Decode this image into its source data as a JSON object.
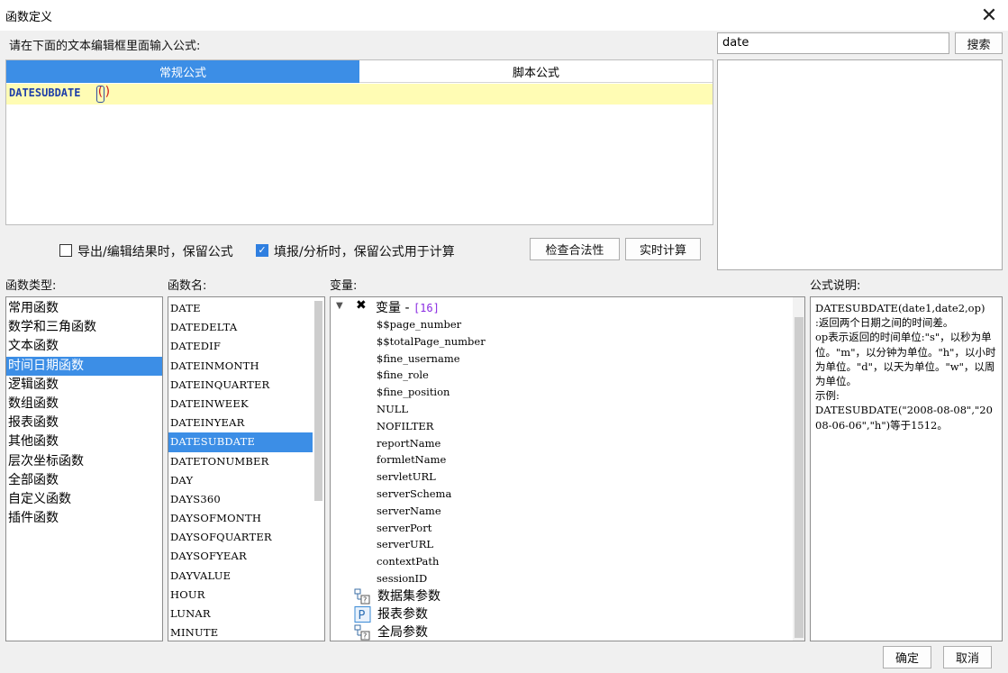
{
  "window": {
    "title": "函数定义",
    "close_glyph": "✕"
  },
  "editor": {
    "prompt": "请在下面的文本编辑框里面输入公式:",
    "tabs": [
      {
        "label": "常规公式",
        "active": true
      },
      {
        "label": "脚本公式",
        "active": false
      }
    ],
    "formula_function": "DATESUBDATE",
    "formula_parens": "()"
  },
  "search": {
    "value": "date",
    "button_label": "搜索"
  },
  "options": {
    "keep_formula_export": {
      "label": "导出/编辑结果时，保留公式",
      "checked": false
    },
    "keep_formula_fill": {
      "label": "填报/分析时，保留公式用于计算",
      "checked": true
    },
    "check_button": "检查合法性",
    "realtime_button": "实时计算"
  },
  "panels": {
    "types_label": "函数类型:",
    "names_label": "函数名:",
    "vars_label": "变量:",
    "desc_label": "公式说明:"
  },
  "function_types": [
    "常用函数",
    "数学和三角函数",
    "文本函数",
    "时间日期函数",
    "逻辑函数",
    "数组函数",
    "报表函数",
    "其他函数",
    "层次坐标函数",
    "全部函数",
    "自定义函数",
    "插件函数"
  ],
  "function_types_selected": 3,
  "function_names": [
    "DATE",
    "DATEDELTA",
    "DATEDIF",
    "DATEINMONTH",
    "DATEINQUARTER",
    "DATEINWEEK",
    "DATEINYEAR",
    "DATESUBDATE",
    "DATETONUMBER",
    "DAY",
    "DAYS360",
    "DAYSOFMONTH",
    "DAYSOFQUARTER",
    "DAYSOFYEAR",
    "DAYVALUE",
    "HOUR",
    "LUNAR",
    "MINUTE"
  ],
  "function_names_selected": 7,
  "variables": {
    "root_label": "变量 - ",
    "root_count": "[16]",
    "items": [
      "$$page_number",
      "$$totalPage_number",
      "$fine_username",
      "$fine_role",
      "$fine_position",
      "NULL",
      "NOFILTER",
      "reportName",
      "formletName",
      "servletURL",
      "serverSchema",
      "serverName",
      "serverPort",
      "serverURL",
      "contextPath",
      "sessionID"
    ],
    "groups": [
      {
        "label": "数据集参数",
        "icon": "dataset-param-icon"
      },
      {
        "label": "报表参数",
        "icon": "p-param-icon"
      },
      {
        "label": "全局参数",
        "icon": "global-param-icon"
      }
    ]
  },
  "description": [
    "DATESUBDATE(date1,date2,op)",
    ":返回两个日期之间的时间差。",
    "op表示返回的时间单位:\"s\"，以秒为单位。\"m\"，以分钟为单位。\"h\"，以小时为单位。\"d\"，以天为单位。\"w\"，以周为单位。",
    "示例:",
    "DATESUBDATE(\"2008-08-08\",\"2008-06-06\",\"h\")等于1512。"
  ],
  "footer": {
    "ok": "确定",
    "cancel": "取消"
  },
  "colors": {
    "accent": "#3c8ee6",
    "formula_line": "#fffcb4",
    "function_text": "#1f3fa8",
    "paren": "#d32020"
  }
}
